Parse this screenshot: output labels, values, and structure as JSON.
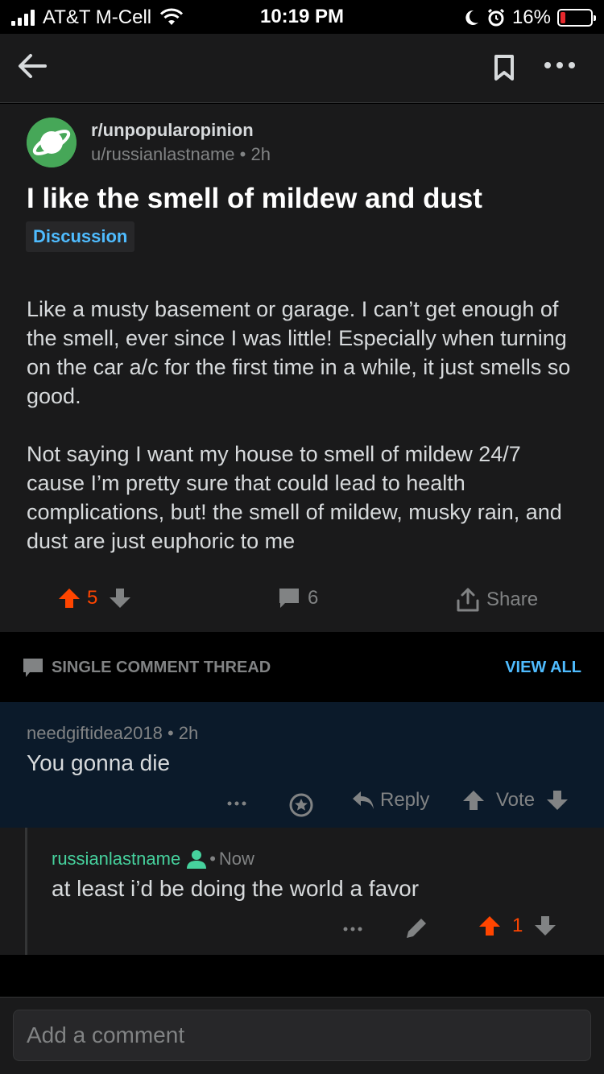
{
  "status_bar": {
    "carrier": "AT&T M-Cell",
    "time": "10:19 PM",
    "battery": "16%",
    "battery_level": 0.16,
    "icons": [
      "signal-icon",
      "wifi-icon",
      "moon-icon",
      "alarm-icon",
      "battery-icon"
    ]
  },
  "nav": {
    "back_icon": "back-arrow-icon",
    "bookmark_icon": "bookmark-icon",
    "more_icon": "more-icon"
  },
  "post": {
    "subreddit": "r/unpopularopinion",
    "author": "u/russianlastname",
    "age": "2h",
    "title": "I like the smell of mildew and dust",
    "flair": "Discussion",
    "paragraphs": [
      "Like a musty basement or garage. I can’t get enough of the smell, ever since I was little! Especially when turning on the car a/c for the first time in a while, it just smells so good.",
      "Not saying I want my house to smell of mildew 24/7 cause I’m pretty sure that could lead to health complications, but! the smell of mildew, musky rain, and dust are just euphoric to me"
    ],
    "score": "5",
    "comments": "6",
    "share_label": "Share"
  },
  "thread": {
    "label": "SINGLE COMMENT THREAD",
    "view_all": "VIEW ALL"
  },
  "comments": [
    {
      "author": "needgiftidea2018",
      "age": "2h",
      "text": "You gonna die",
      "reply_label": "Reply",
      "vote_label": "Vote"
    },
    {
      "author": "russianlastname",
      "age": "Now",
      "text": "at least i’d be doing the world a favor",
      "score": "1"
    }
  ],
  "composer": {
    "placeholder": "Add a comment"
  },
  "colors": {
    "background": "#1a1a1b",
    "upvote": "#ff4500",
    "link": "#4fbcff",
    "op_name": "#46d19d",
    "highlight": "#0b1a2a"
  }
}
